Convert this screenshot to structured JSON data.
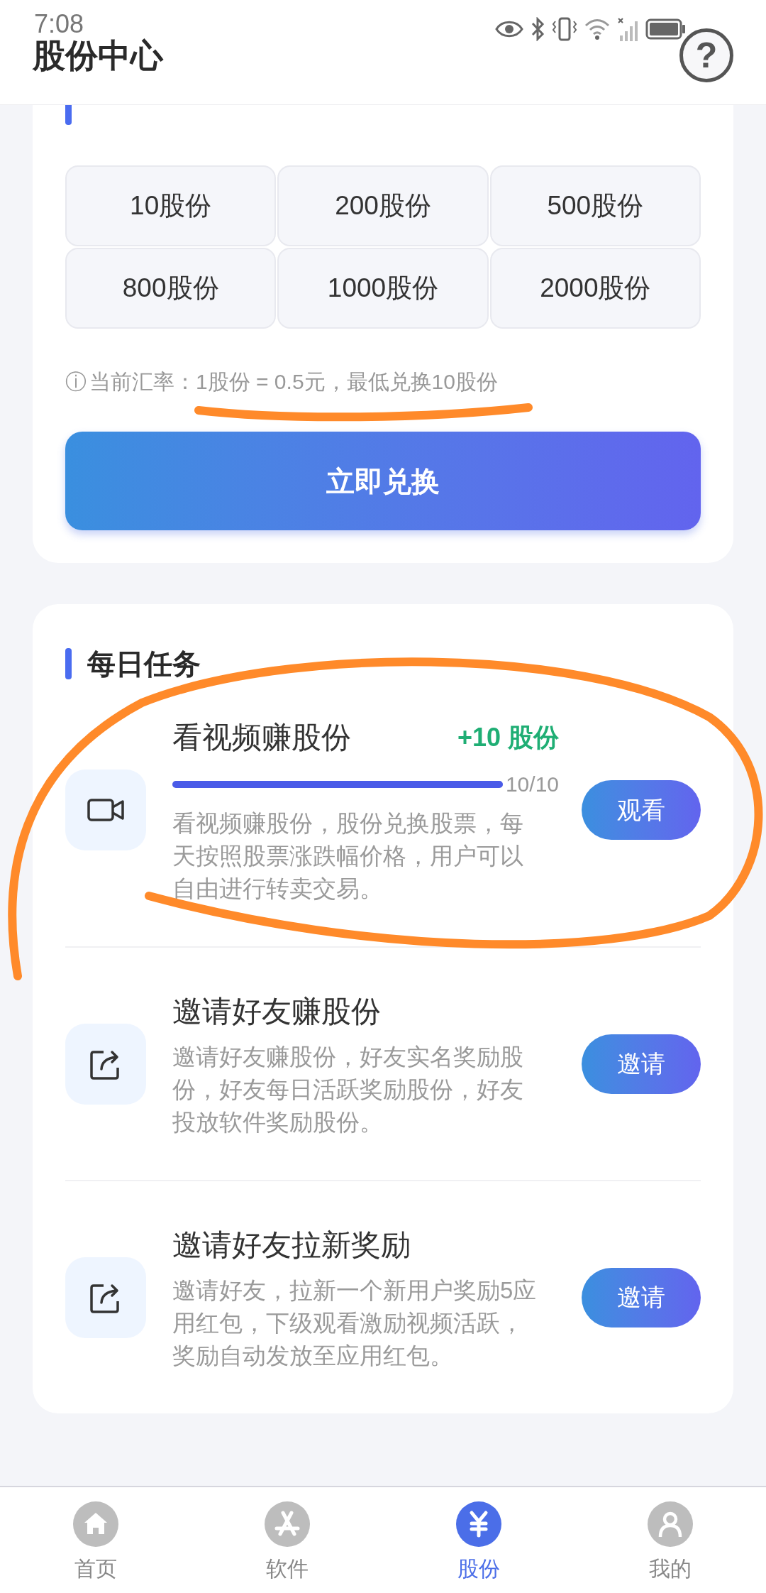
{
  "status_bar": {
    "time": "7:08"
  },
  "header": {
    "title": "股份中心",
    "help_label": "?"
  },
  "exchange": {
    "options": [
      {
        "label": "10股份"
      },
      {
        "label": "200股份"
      },
      {
        "label": "500股份"
      },
      {
        "label": "800股份"
      },
      {
        "label": "1000股份"
      },
      {
        "label": "2000股份"
      }
    ],
    "note_icon": "ⓘ",
    "note": "当前汇率：1股份 = 0.5元，最低兑换10股份",
    "button": "立即兑换"
  },
  "tasks_section": {
    "title": "每日任务",
    "tasks": [
      {
        "kind": "video",
        "title": "看视频赚股份",
        "reward": "+10 股份",
        "progress": {
          "level": 1,
          "reading": "10/10"
        },
        "description": "看视频赚股份，股份兑换股票，每天按照股票涨跌幅价格，用户可以自由进行转卖交易。",
        "button": "观看"
      },
      {
        "kind": "share",
        "title": "邀请好友赚股份",
        "description": "邀请好友赚股份，好友实名奖励股份，好友每日活跃奖励股份，好友投放软件奖励股份。",
        "button": "邀请"
      },
      {
        "kind": "share",
        "title": "邀请好友拉新奖励",
        "description": "邀请好友，拉新一个新用户奖励5应用红包，下级观看激励视频活跃，奖励自动发放至应用红包。",
        "button": "邀请"
      }
    ]
  },
  "bottom_nav": [
    {
      "kind": "home",
      "label": "首页",
      "selected": false
    },
    {
      "kind": "apps",
      "label": "软件",
      "selected": false
    },
    {
      "kind": "yuan",
      "label": "股份",
      "selected": true
    },
    {
      "kind": "person",
      "label": "我的",
      "selected": false
    }
  ]
}
